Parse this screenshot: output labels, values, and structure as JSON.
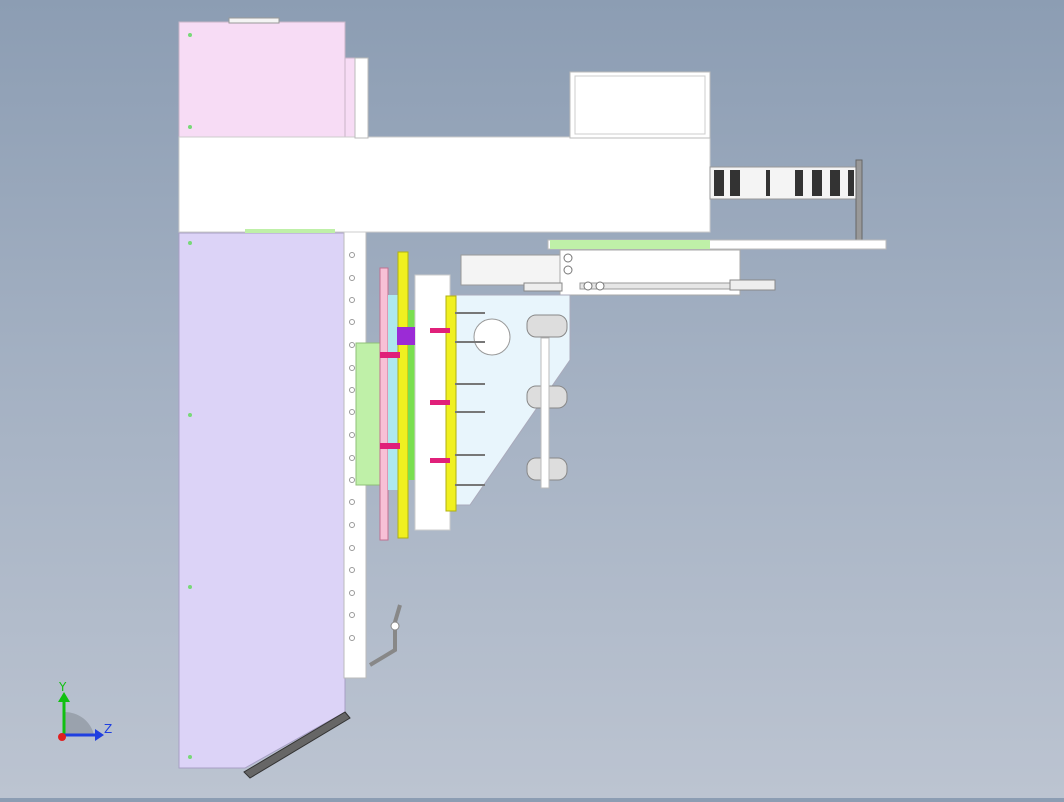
{
  "viewport": {
    "background_top": "#8c9db3",
    "background_bottom": "#bcc4d1"
  },
  "triad": {
    "y_label": "Y",
    "z_label": "Z",
    "colors": {
      "y": "#11c011",
      "z": "#1f3fe0",
      "x": "#e01f1f"
    }
  },
  "model": {
    "colors": {
      "panel_pink": "#f7dcf5",
      "panel_lilac": "#dcd3f7",
      "white_parts": "#ffffff",
      "accent_yellow": "#f0f020",
      "accent_green": "#bff0a8",
      "accent_magenta": "#e0207a",
      "accent_purple": "#9b2bd6",
      "accent_cyan": "#aee8ee",
      "chain_dark": "#333333",
      "scraper_gray": "#666666"
    }
  }
}
